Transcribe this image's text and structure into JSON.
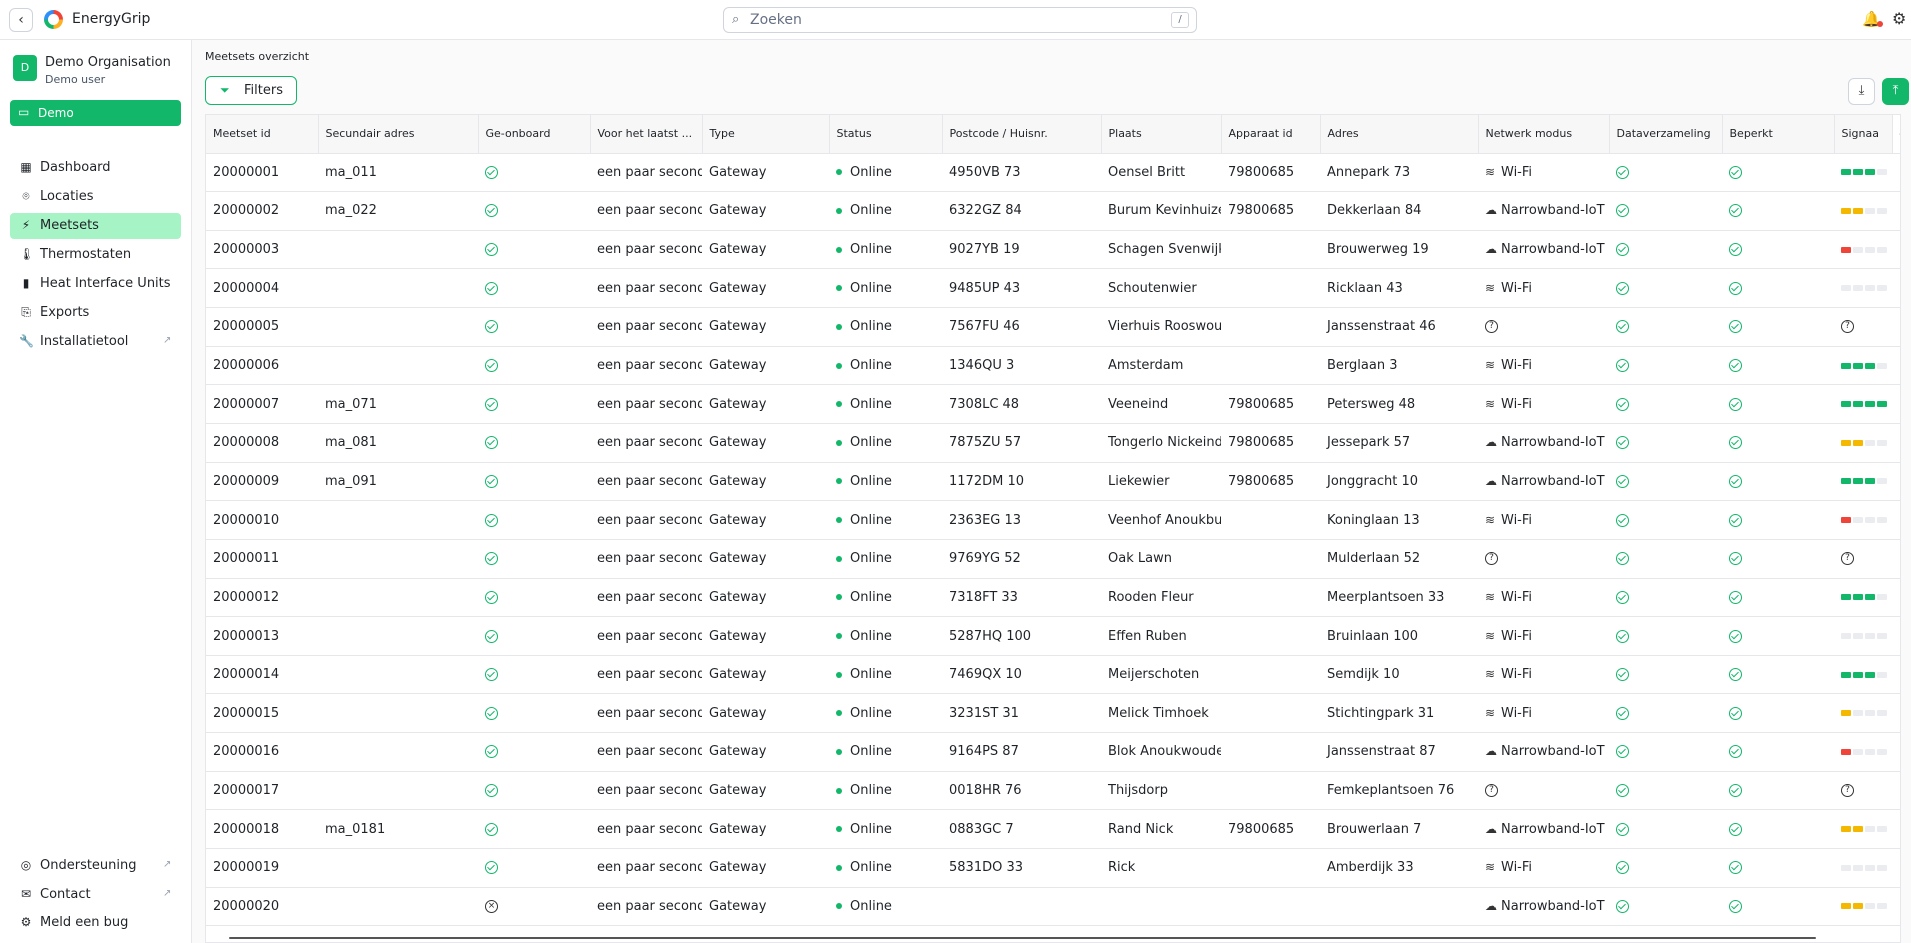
{
  "app": {
    "title": "EnergyGrip"
  },
  "search": {
    "placeholder": "Zoeken",
    "shortcut": "/"
  },
  "org": {
    "initial": "D",
    "name": "Demo Organisation",
    "user": "Demo user"
  },
  "demo": {
    "label": "Demo"
  },
  "nav": [
    {
      "label": "Dashboard",
      "icon": "dashboard-icon"
    },
    {
      "label": "Locaties",
      "icon": "location-pin-icon"
    },
    {
      "label": "Meetsets",
      "icon": "plug-icon"
    },
    {
      "label": "Thermostaten",
      "icon": "thermometer-icon"
    },
    {
      "label": "Heat Interface Units",
      "icon": "heat-unit-icon"
    },
    {
      "label": "Exports",
      "icon": "export-icon"
    },
    {
      "label": "Installatietool",
      "icon": "wrench-icon"
    }
  ],
  "footer_nav": [
    {
      "label": "Ondersteuning",
      "icon": "support-icon"
    },
    {
      "label": "Contact",
      "icon": "mail-icon"
    },
    {
      "label": "Meld een bug",
      "icon": "bug-icon"
    }
  ],
  "page": {
    "title": "Meetsets overzicht",
    "filters_label": "Filters"
  },
  "colors": {
    "accent": "#12b76a",
    "active_nav": "#a6f4c5",
    "signal_green": "#12b76a",
    "signal_yellow": "#f5b800",
    "signal_red": "#f04438"
  },
  "columns": [
    "Meetset id",
    "Secundair adres",
    "Ge-onboard",
    "Voor het laatst ...",
    "Type",
    "Status",
    "Postcode / Huisnr.",
    "Plaats",
    "Apparaat id",
    "Adres",
    "Netwerk modus",
    "Dataverzameling",
    "Beperkt",
    "Signaa",
    "+"
  ],
  "rows": [
    {
      "id": "20000001",
      "sec": "ma_011",
      "onb": "ok",
      "last": "een paar seconden",
      "type": "Gateway",
      "status": "Online",
      "pc": "4950VB 73",
      "plaats": "Oensel Britt",
      "app": "79800685",
      "adres": "Annepark 73",
      "net": "Wi-Fi",
      "data": "ok",
      "bep": "ok",
      "sig": {
        "count": 3,
        "color": "green"
      },
      "sign": "8"
    },
    {
      "id": "20000002",
      "sec": "ma_022",
      "onb": "ok",
      "last": "een paar seconden",
      "type": "Gateway",
      "status": "Online",
      "pc": "6322GZ 84",
      "plaats": "Burum Kevinhuizen",
      "app": "79800685",
      "adres": "Dekkerlaan 84",
      "net": "Narrowband-IoT",
      "data": "ok",
      "bep": "ok",
      "sig": {
        "count": 2,
        "color": "yellow"
      },
      "sign": "5"
    },
    {
      "id": "20000003",
      "sec": "",
      "onb": "ok",
      "last": "een paar seconden",
      "type": "Gateway",
      "status": "Online",
      "pc": "9027YB 19",
      "plaats": "Schagen Svenwijk",
      "app": "",
      "adres": "Brouwerweg 19",
      "net": "Narrowband-IoT",
      "data": "ok",
      "bep": "ok",
      "sig": {
        "count": 1,
        "color": "red"
      },
      "sign": "2"
    },
    {
      "id": "20000004",
      "sec": "",
      "onb": "ok",
      "last": "een paar seconden",
      "type": "Gateway",
      "status": "Online",
      "pc": "9485UP 43",
      "plaats": "Schoutenwier",
      "app": "",
      "adres": "Ricklaan 43",
      "net": "Wi-Fi",
      "data": "ok",
      "bep": "ok",
      "sig": {
        "count": 0,
        "color": "none"
      },
      "sign": "4"
    },
    {
      "id": "20000005",
      "sec": "",
      "onb": "ok",
      "last": "een paar seconden",
      "type": "Gateway",
      "status": "Online",
      "pc": "7567FU 46",
      "plaats": "Vierhuis Rooswoude",
      "app": "",
      "adres": "Janssenstraat 46",
      "net": "",
      "data": "ok",
      "bep": "ok",
      "sig": {
        "count": -1,
        "color": "unknown"
      },
      "sign": ""
    },
    {
      "id": "20000006",
      "sec": "",
      "onb": "ok",
      "last": "een paar seconden",
      "type": "Gateway",
      "status": "Online",
      "pc": "1346QU 3",
      "plaats": "Amsterdam",
      "app": "",
      "adres": "Berglaan 3",
      "net": "Wi-Fi",
      "data": "ok",
      "bep": "ok",
      "sig": {
        "count": 3,
        "color": "green"
      },
      "sign": "7"
    },
    {
      "id": "20000007",
      "sec": "ma_071",
      "onb": "ok",
      "last": "een paar seconden",
      "type": "Gateway",
      "status": "Online",
      "pc": "7308LC 48",
      "plaats": "Veeneind",
      "app": "79800685",
      "adres": "Petersweg 48",
      "net": "Wi-Fi",
      "data": "ok",
      "bep": "ok",
      "sig": {
        "count": 4,
        "color": "green"
      },
      "sign": "9"
    },
    {
      "id": "20000008",
      "sec": "ma_081",
      "onb": "ok",
      "last": "een paar seconden",
      "type": "Gateway",
      "status": "Online",
      "pc": "7875ZU 57",
      "plaats": "Tongerlo Nickeind",
      "app": "79800685",
      "adres": "Jessepark 57",
      "net": "Narrowband-IoT",
      "data": "ok",
      "bep": "ok",
      "sig": {
        "count": 2,
        "color": "yellow"
      },
      "sign": "5"
    },
    {
      "id": "20000009",
      "sec": "ma_091",
      "onb": "ok",
      "last": "een paar seconden",
      "type": "Gateway",
      "status": "Online",
      "pc": "1172DM 10",
      "plaats": "Liekewier",
      "app": "79800685",
      "adres": "Jonggracht 10",
      "net": "Narrowband-IoT",
      "data": "ok",
      "bep": "ok",
      "sig": {
        "count": 3,
        "color": "green"
      },
      "sign": "7"
    },
    {
      "id": "20000010",
      "sec": "",
      "onb": "ok",
      "last": "een paar seconden",
      "type": "Gateway",
      "status": "Online",
      "pc": "2363EG 13",
      "plaats": "Veenhof Anoukbuurt",
      "app": "",
      "adres": "Koninglaan 13",
      "net": "Wi-Fi",
      "data": "ok",
      "bep": "ok",
      "sig": {
        "count": 1,
        "color": "red"
      },
      "sign": "1"
    },
    {
      "id": "20000011",
      "sec": "",
      "onb": "ok",
      "last": "een paar seconden",
      "type": "Gateway",
      "status": "Online",
      "pc": "9769YG 52",
      "plaats": "Oak Lawn",
      "app": "",
      "adres": "Mulderlaan 52",
      "net": "",
      "data": "ok",
      "bep": "ok",
      "sig": {
        "count": -1,
        "color": "unknown"
      },
      "sign": ""
    },
    {
      "id": "20000012",
      "sec": "",
      "onb": "ok",
      "last": "een paar seconden",
      "type": "Gateway",
      "status": "Online",
      "pc": "7318FT 33",
      "plaats": "Rooden Fleur",
      "app": "",
      "adres": "Meerplantsoen 33",
      "net": "Wi-Fi",
      "data": "ok",
      "bep": "ok",
      "sig": {
        "count": 3,
        "color": "green"
      },
      "sign": "6"
    },
    {
      "id": "20000013",
      "sec": "",
      "onb": "ok",
      "last": "een paar seconden",
      "type": "Gateway",
      "status": "Online",
      "pc": "5287HQ 100",
      "plaats": "Effen Ruben",
      "app": "",
      "adres": "Bruinlaan 100",
      "net": "Wi-Fi",
      "data": "ok",
      "bep": "ok",
      "sig": {
        "count": 0,
        "color": "none"
      },
      "sign": "1"
    },
    {
      "id": "20000014",
      "sec": "",
      "onb": "ok",
      "last": "een paar seconden",
      "type": "Gateway",
      "status": "Online",
      "pc": "7469QX 10",
      "plaats": "Meijerschoten",
      "app": "",
      "adres": "Semdijk 10",
      "net": "Wi-Fi",
      "data": "ok",
      "bep": "ok",
      "sig": {
        "count": 3,
        "color": "green"
      },
      "sign": "8"
    },
    {
      "id": "20000015",
      "sec": "",
      "onb": "ok",
      "last": "een paar seconden",
      "type": "Gateway",
      "status": "Online",
      "pc": "3231ST 31",
      "plaats": "Melick Timhoek",
      "app": "",
      "adres": "Stichtingpark 31",
      "net": "Wi-Fi",
      "data": "ok",
      "bep": "ok",
      "sig": {
        "count": 1,
        "color": "yellow"
      },
      "sign": "3"
    },
    {
      "id": "20000016",
      "sec": "",
      "onb": "ok",
      "last": "een paar seconden",
      "type": "Gateway",
      "status": "Online",
      "pc": "9164PS 87",
      "plaats": "Blok Anoukwoude",
      "app": "",
      "adres": "Janssenstraat 87",
      "net": "Narrowband-IoT",
      "data": "ok",
      "bep": "ok",
      "sig": {
        "count": 1,
        "color": "red"
      },
      "sign": "2"
    },
    {
      "id": "20000017",
      "sec": "",
      "onb": "ok",
      "last": "een paar seconden",
      "type": "Gateway",
      "status": "Online",
      "pc": "0018HR 76",
      "plaats": "Thijsdorp",
      "app": "",
      "adres": "Femkeplantsoen 76",
      "net": "",
      "data": "ok",
      "bep": "ok",
      "sig": {
        "count": -1,
        "color": "unknown"
      },
      "sign": ""
    },
    {
      "id": "20000018",
      "sec": "ma_0181",
      "onb": "ok",
      "last": "een paar seconden",
      "type": "Gateway",
      "status": "Online",
      "pc": "0883GC 7",
      "plaats": "Rand Nick",
      "app": "79800685",
      "adres": "Brouwerlaan 7",
      "net": "Narrowband-IoT",
      "data": "ok",
      "bep": "ok",
      "sig": {
        "count": 2,
        "color": "yellow"
      },
      "sign": "5"
    },
    {
      "id": "20000019",
      "sec": "",
      "onb": "ok",
      "last": "een paar seconden",
      "type": "Gateway",
      "status": "Online",
      "pc": "5831DO 33",
      "plaats": "Rick",
      "app": "",
      "adres": "Amberdijk 33",
      "net": "Wi-Fi",
      "data": "ok",
      "bep": "ok",
      "sig": {
        "count": 0,
        "color": "none"
      },
      "sign": "3"
    },
    {
      "id": "20000020",
      "sec": "",
      "onb": "no",
      "last": "een paar seconden",
      "type": "Gateway",
      "status": "Online",
      "pc": "",
      "plaats": "",
      "app": "",
      "adres": "",
      "net": "Narrowband-IoT",
      "data": "ok",
      "bep": "ok",
      "sig": {
        "count": 2,
        "color": "yellow"
      },
      "sign": "5"
    }
  ]
}
